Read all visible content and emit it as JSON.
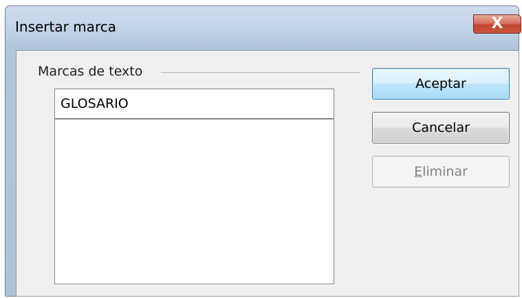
{
  "window": {
    "title": "Insertar marca",
    "close_glyph": "X"
  },
  "group": {
    "label": "Marcas de texto"
  },
  "input": {
    "value": "GLOSARIO"
  },
  "list": {
    "items": []
  },
  "buttons": {
    "accept_label": "Aceptar",
    "cancel_label": "Cancelar",
    "delete_mnemonic": "E",
    "delete_rest": "liminar"
  },
  "colors": {
    "client_bg": "#f0f0f0",
    "title_bar": "#bdd0e4",
    "close_red": "#c3452e",
    "default_button_border": "#3c7fb1",
    "disabled_text": "#838383"
  },
  "icons": {
    "close": "close-icon"
  }
}
